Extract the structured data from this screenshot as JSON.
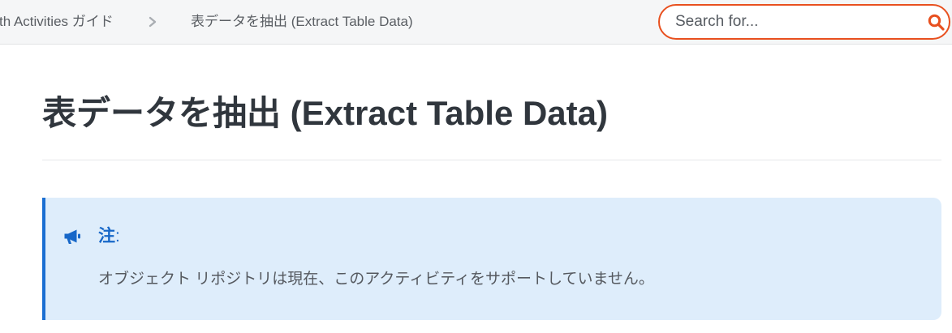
{
  "breadcrumb": {
    "parent": "th Activities ガイド",
    "separator_icon": "chevron-right-icon",
    "current": "表データを抽出 (Extract Table Data)"
  },
  "search": {
    "placeholder": "Search for...",
    "icon": "search-icon"
  },
  "page": {
    "title": "表データを抽出 (Extract Table Data)"
  },
  "note": {
    "icon": "megaphone-icon",
    "label": "注",
    "label_suffix": ":",
    "text": "オブジェクト リポジトリは現在、このアクティビティをサポートしていません。"
  },
  "colors": {
    "accent": "#e8501f",
    "topbar_bg": "#f5f6f7",
    "breadcrumb_text": "#5a5e63",
    "title_text": "#30363d",
    "note_bg": "#deedfb",
    "note_border": "#1b6fd2",
    "note_label": "#1767c8",
    "note_text": "#55595f"
  }
}
